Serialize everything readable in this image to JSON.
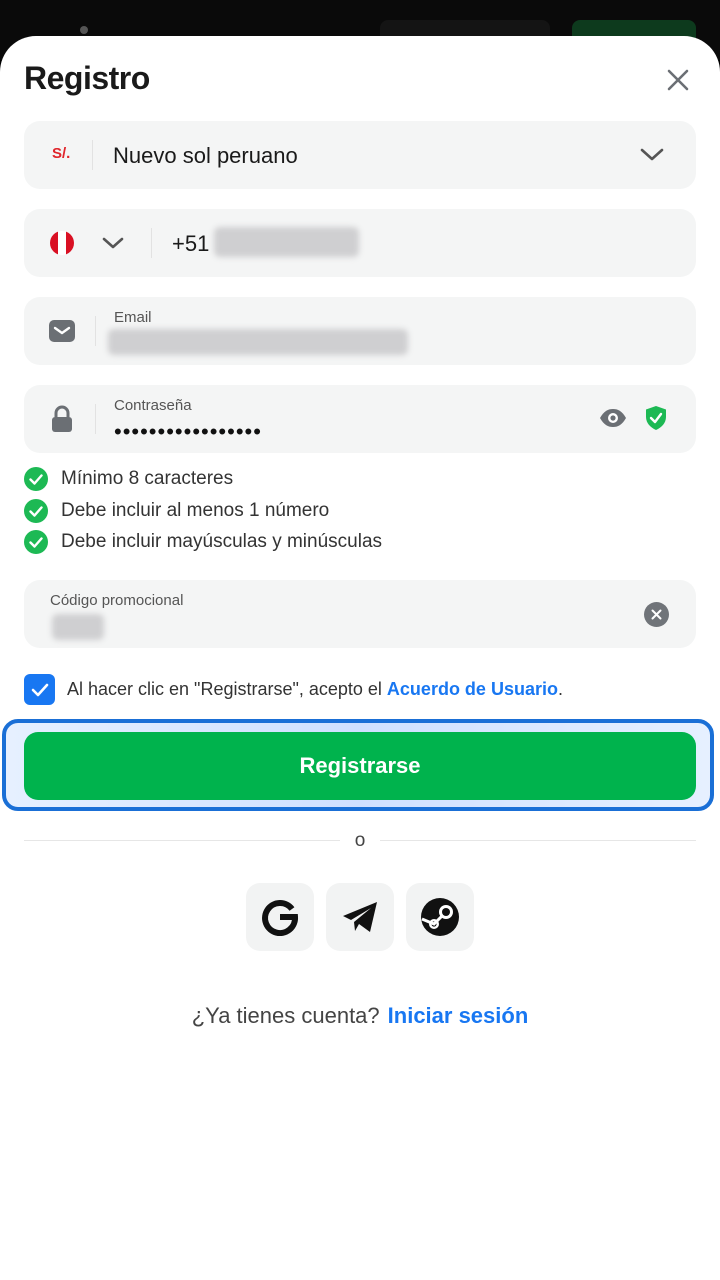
{
  "title": "Registro",
  "currency": {
    "badge": "S/.",
    "label": "Nuevo sol peruano"
  },
  "phone": {
    "prefix": "+51"
  },
  "email": {
    "label": "Email"
  },
  "password": {
    "label": "Contraseña",
    "masked_value": "•••••••••••••••••"
  },
  "requirements": [
    "Mínimo 8 caracteres",
    "Debe incluir al menos 1 número",
    "Debe incluir mayúsculas y minúsculas"
  ],
  "promo": {
    "label": "Código promocional"
  },
  "agreement": {
    "text": "Al hacer clic en \"Registrarse\", acepto el ",
    "link": "Acuerdo de Usuario",
    "suffix": "."
  },
  "register_button": "Registrarse",
  "divider_text": "o",
  "social": [
    "google-icon",
    "telegram-icon",
    "steam-icon"
  ],
  "footer": {
    "question": "¿Ya tienes cuenta?",
    "link": "Iniciar sesión"
  },
  "colors": {
    "primary_green": "#00b34d",
    "link_blue": "#1877f2",
    "highlight_blue": "#1a6fd6",
    "check_green": "#1db954"
  }
}
